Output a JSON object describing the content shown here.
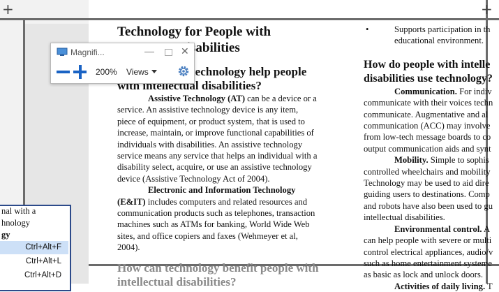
{
  "document": {
    "col1": {
      "title_line1": "Technology for People with",
      "title_line2": "Disabilities",
      "heading1_line1": "technology help people",
      "heading1_line2": "with intellectual disabilities?",
      "p1_lines": [
        "Assistive Technology (AT) can be a device or a",
        "service.  An assistive technology device is any item,",
        "piece of equipment, or product system, that is used to",
        "increase, maintain, or improve functional capabilities of",
        "individuals with disabilities.  An assistive technology",
        "service means any service that helps an individual with a",
        "disability select, acquire, or use an assistive technology",
        "device (Assistive Technology Act of 2004)."
      ],
      "p2_lines": [
        "Electronic and Information Technology",
        "(E&IT) includes computers and related resources and",
        "communication products such as telephones, transaction",
        "machines such as ATMs for banking, World Wide Web",
        "sites, and office copiers and faxes (Wehmeyer et al,",
        "2004)."
      ],
      "heading2_line1": "How can technology benefit people with",
      "heading2_line2": "intellectual disabilities?"
    },
    "col2": {
      "bullet_line1": "Supports participation in th",
      "bullet_line2": "educational environment.",
      "heading_line1": "How do people with intelle",
      "heading_line2": "disabilities use technology?",
      "lines": [
        "Communication.  For indiv",
        "communicate with their voices techn",
        "communicate.  Augmentative and al",
        "communication (ACC) may involve",
        "from low-tech message boards to co",
        "output communication aids and synt",
        "Mobility.  Simple to sophis",
        "controlled wheelchairs and mobility",
        "Technology may be used to aid dire",
        "guiding users to destinations. Comp",
        "and robots have also been used to gu",
        "intellectual disabilities.",
        "Environmental control. A",
        "can help people with severe or multi",
        "control electrical appliances, audio/v",
        "such as home entertainment systeme",
        "as basic as lock and unlock doors.",
        "Activities of daily living. T"
      ]
    }
  },
  "magnifier": {
    "title": "Magnifi...",
    "minimize": "—",
    "close": "✕",
    "zoom_level": "200%",
    "views_label": "Views",
    "zoom_out_icon": "minus-icon",
    "zoom_in_icon": "plus-icon",
    "settings_icon": "gear-icon",
    "accent": "#1a63c4"
  },
  "popup": {
    "line1": "nal with a",
    "line2": "hnology",
    "line3": "gy",
    "items": [
      {
        "shortcut": "Ctrl+Alt+F",
        "selected": true
      },
      {
        "shortcut": "Ctrl+Alt+L",
        "selected": false
      },
      {
        "shortcut": "Ctrl+Alt+D",
        "selected": false
      }
    ]
  }
}
